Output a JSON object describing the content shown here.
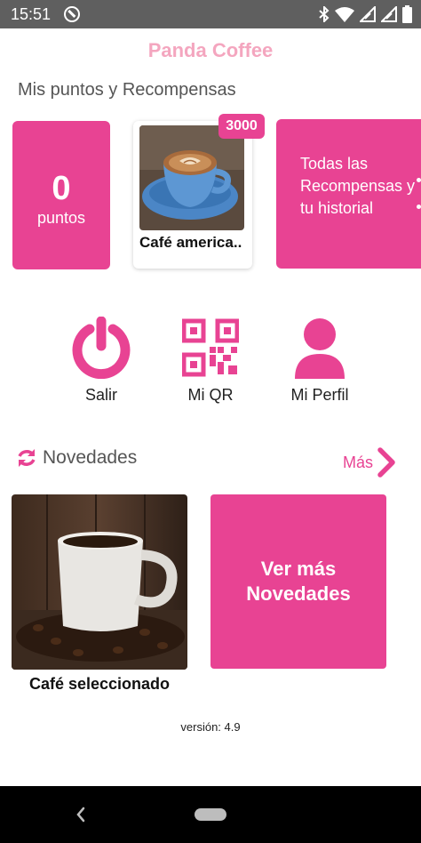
{
  "status_bar": {
    "time": "15:51",
    "icons": [
      "sync-icon",
      "bluetooth-icon",
      "wifi-icon",
      "signal-icon",
      "battery-icon"
    ]
  },
  "app": {
    "title": "Panda Coffee",
    "accent_color": "#e84393",
    "title_color": "#f4a6bf"
  },
  "rewards": {
    "heading": "Mis puntos y Recompensas",
    "points_value": "0",
    "points_label": "puntos",
    "reward_item": {
      "name": "Café america..",
      "cost_badge": "3000",
      "image": "coffee-cup-photo"
    },
    "all_rewards_label": "Todas las Recompensas y tu historial"
  },
  "actions": [
    {
      "label": "Salir",
      "icon": "power-icon"
    },
    {
      "label": "Mi QR",
      "icon": "qr-code-icon"
    },
    {
      "label": "Mi Perfil",
      "icon": "user-icon"
    }
  ],
  "news": {
    "heading": "Novedades",
    "more_label": "Más",
    "item_caption": "Café seleccionado",
    "see_more_label": "Ver más Novedades"
  },
  "footer": {
    "version": "versión: 4.9"
  }
}
